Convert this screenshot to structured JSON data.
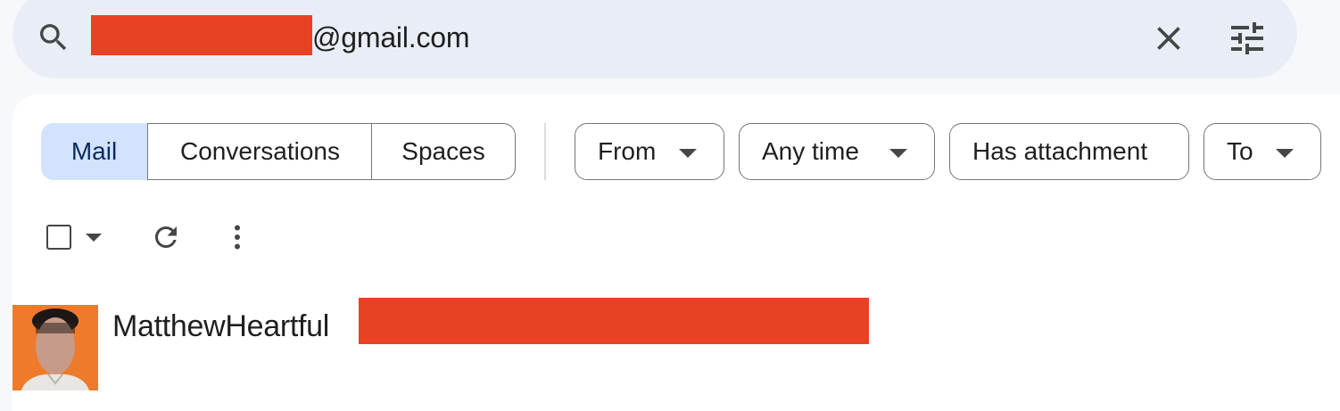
{
  "search": {
    "query_suffix": "@gmail.com",
    "redaction_color": "#e94125"
  },
  "scope_tabs": [
    {
      "label": "Mail",
      "selected": true
    },
    {
      "label": "Conversations",
      "selected": false
    },
    {
      "label": "Spaces",
      "selected": false
    }
  ],
  "filters": [
    {
      "label": "From",
      "dropdown": true
    },
    {
      "label": "Any time",
      "dropdown": true
    },
    {
      "label": "Has attachment",
      "dropdown": false
    },
    {
      "label": "To",
      "dropdown": true
    }
  ],
  "toolbar": {
    "icons": [
      "checkbox-icon",
      "chevron-down-icon",
      "refresh-icon",
      "more-vert-icon"
    ]
  },
  "result": {
    "name": "MatthewHeartful",
    "avatar_bg": "#ee7a2c"
  },
  "colors": {
    "accent_selected": "#d3e3fd",
    "searchbar_bg": "#e9eef6",
    "page_bg": "#f6f8fc"
  }
}
